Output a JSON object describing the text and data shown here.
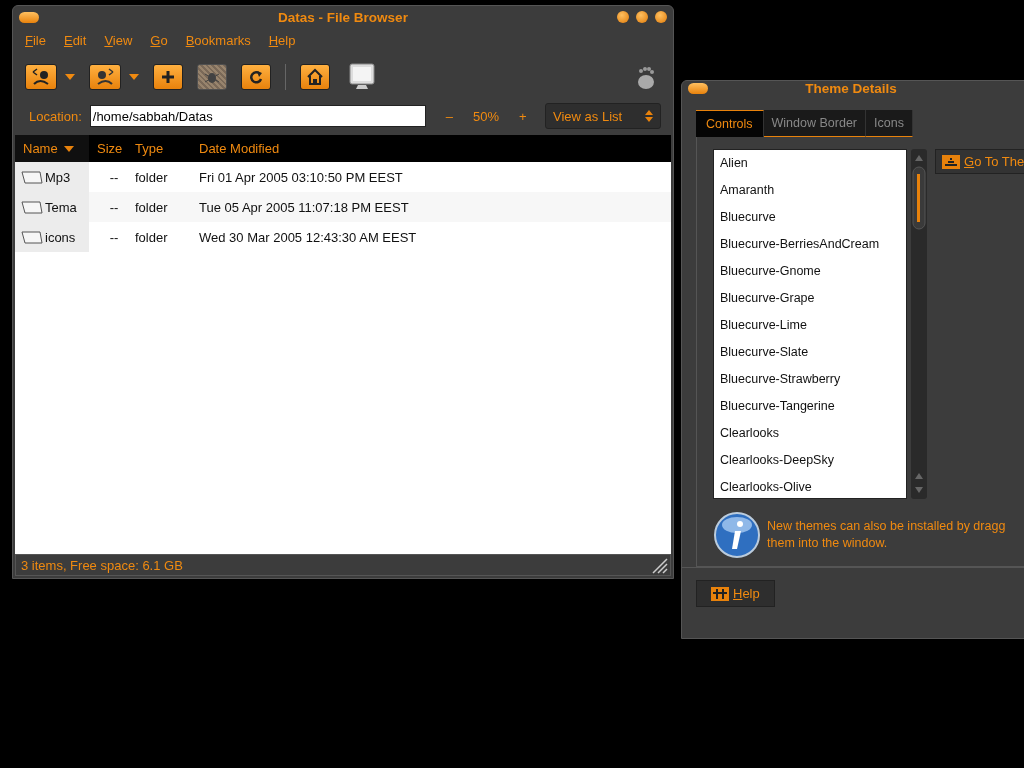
{
  "file_browser": {
    "title": "Datas - File Browser",
    "menu": [
      "File",
      "Edit",
      "View",
      "Go",
      "Bookmarks",
      "Help"
    ],
    "toolbar": [
      {
        "kind": "back",
        "disabled": false
      },
      {
        "kind": "forward",
        "disabled": false
      },
      {
        "kind": "new",
        "disabled": false
      },
      {
        "kind": "stop",
        "disabled": true
      },
      {
        "kind": "reload",
        "disabled": false
      },
      {
        "kind": "home",
        "disabled": false
      },
      {
        "kind": "computer",
        "disabled": false
      }
    ],
    "location_label": "Location:",
    "location": "/home/sabbah/Datas",
    "zoom_out": "–",
    "zoom": "50%",
    "zoom_in": "+",
    "view_mode": "View as List",
    "columns": [
      {
        "label": "Name",
        "sorted": true
      },
      {
        "label": "Size",
        "sorted": false
      },
      {
        "label": "Type",
        "sorted": false
      },
      {
        "label": "Date Modified",
        "sorted": false
      }
    ],
    "rows": [
      {
        "name": "Mp3",
        "size": "--",
        "type": "folder",
        "date": "Fri 01 Apr 2005 03:10:50 PM EEST"
      },
      {
        "name": "Tema",
        "size": "--",
        "type": "folder",
        "date": "Tue 05 Apr 2005 11:07:18 PM EEST"
      },
      {
        "name": "icons",
        "size": "--",
        "type": "folder",
        "date": "Wed 30 Mar 2005 12:43:30 AM EEST"
      }
    ],
    "status_bar": "3 items, Free space: 6.1 GB"
  },
  "theme_details": {
    "title": "Theme Details",
    "tabs": [
      {
        "label": "Controls",
        "selected": true
      },
      {
        "label": "Window Border",
        "selected": false
      },
      {
        "label": "Icons",
        "selected": false
      }
    ],
    "themes": [
      "Alien",
      "Amaranth",
      "Bluecurve",
      "Bluecurve-BerriesAndCream",
      "Bluecurve-Gnome",
      "Bluecurve-Grape",
      "Bluecurve-Lime",
      "Bluecurve-Slate",
      "Bluecurve-Strawberry",
      "Bluecurve-Tangerine",
      "Clearlooks",
      "Clearlooks-DeepSky",
      "Clearlooks-Olive"
    ],
    "go_button": "Go To The",
    "info": [
      "New themes can also be installed by dragg",
      "them into the window."
    ],
    "help_button": "Help"
  }
}
